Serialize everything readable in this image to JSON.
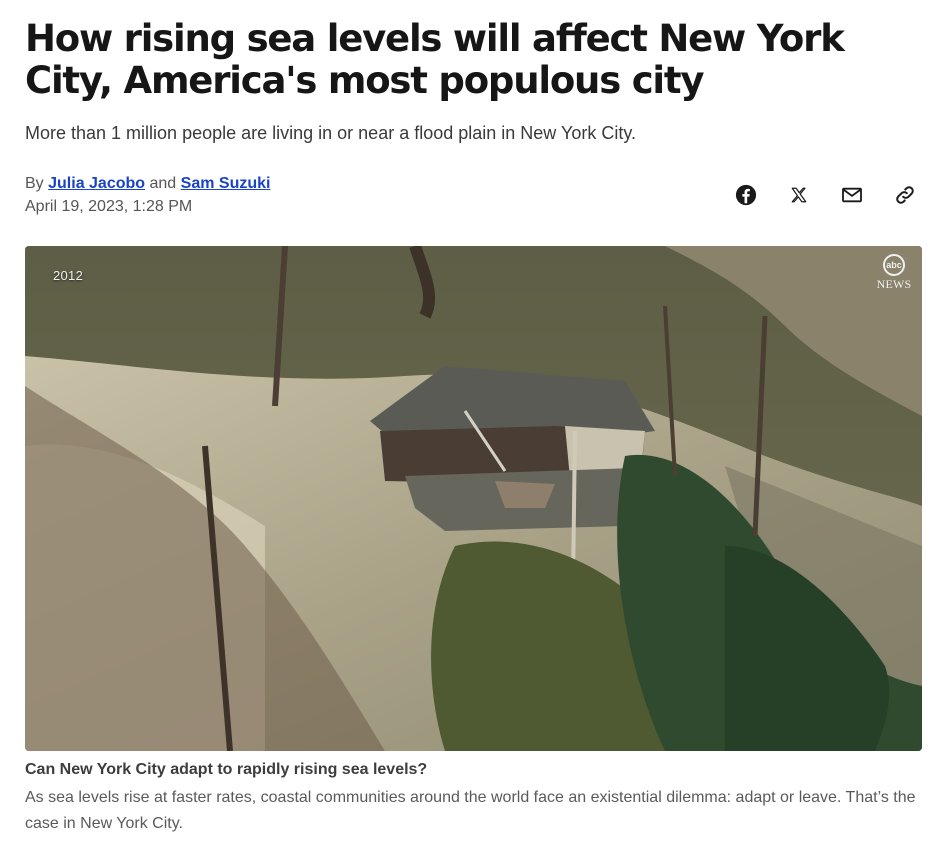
{
  "article": {
    "headline": "How rising sea levels will affect New York City, America's most populous city",
    "subheadline": "More than 1 million people are living in or near a flood plain in New York City.",
    "byline": {
      "prefix": "By",
      "author_1": "Julia Jacobo",
      "conjunction": "and",
      "author_2": "Sam Suzuki"
    },
    "date": "April 19, 2023, 1:28 PM"
  },
  "share": {
    "icons": [
      "facebook-icon",
      "x-icon",
      "mail-icon",
      "link-icon"
    ]
  },
  "video": {
    "year_label": "2012",
    "logo_mark": "abc",
    "logo_text": "NEWS",
    "title": "Can New York City adapt to rapidly rising sea levels?",
    "description": "As sea levels rise at faster rates, coastal communities around the world face an existential dilemma: adapt or leave. That’s the case in New York City."
  },
  "colors": {
    "author_link": "#1a44c8",
    "headline": "#161616"
  }
}
